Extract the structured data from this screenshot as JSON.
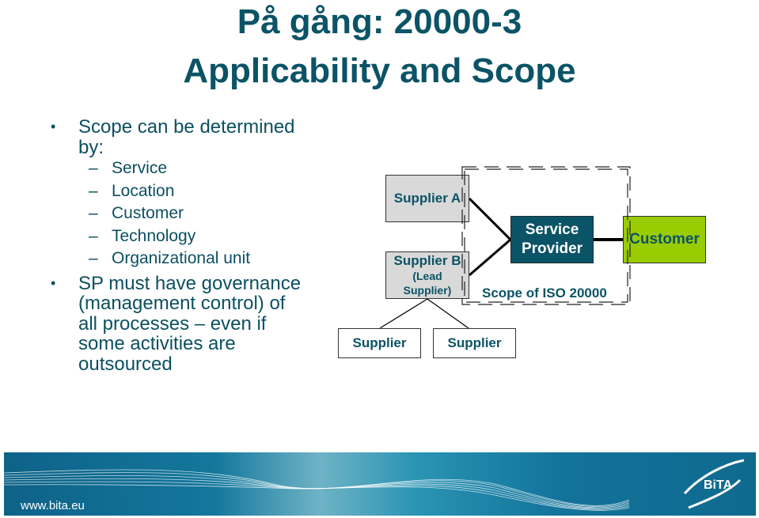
{
  "title": {
    "line1": "På gång: 20000-3",
    "line2": "Applicability and Scope"
  },
  "bullets": [
    {
      "text": "Scope can be determined by:",
      "subitems": [
        "Service",
        "Location",
        "Customer",
        "Technology",
        "Organizational unit"
      ]
    },
    {
      "text": "SP must have governance (management control) of all processes – even if some activities are outsourced"
    }
  ],
  "bullet_symbol": "•",
  "dash_symbol": "–",
  "diagram": {
    "supplier_a": "Supplier A",
    "supplier_b": "Supplier B",
    "supplier_b_sub": "(Lead Supplier)",
    "service_provider": "Service Provider",
    "customer": "Customer",
    "supplier_left": "Supplier",
    "supplier_right": "Supplier",
    "scope_label": "Scope of ISO 20000",
    "colors": {
      "service_provider_fill": "#0b5366",
      "customer_fill": "#99cc00",
      "supplier_fill": "#d9d9d9",
      "text": "#0b5366"
    }
  },
  "footer": {
    "url": "www.bita.eu",
    "logo": "BiTA",
    "logo-icon": "bita-swoosh-icon",
    "color": "#0f6a8e"
  }
}
